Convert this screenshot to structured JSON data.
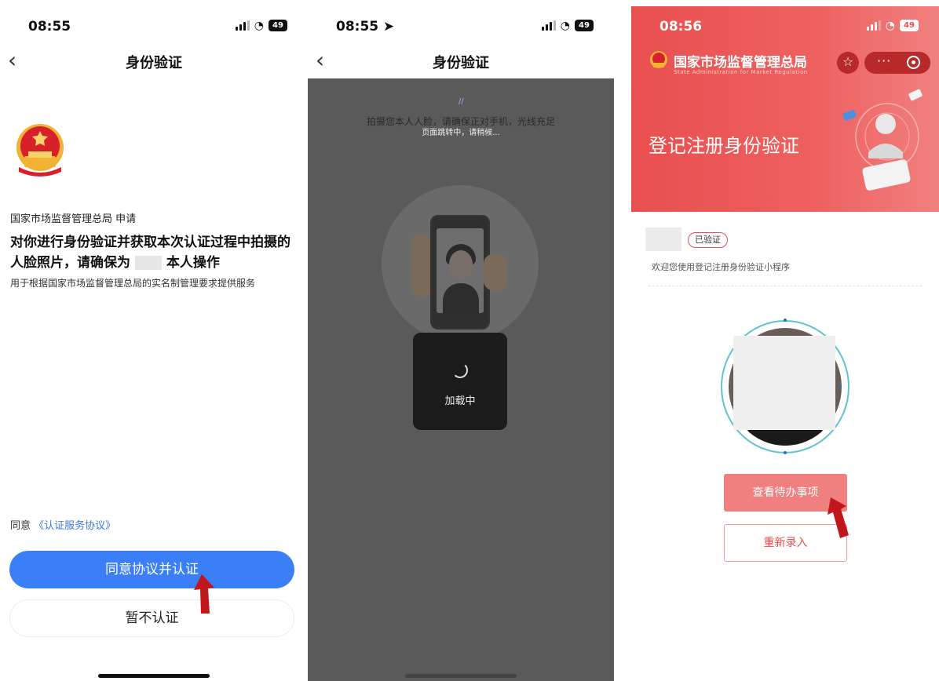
{
  "panel1": {
    "status": {
      "time": "08:55",
      "battery": "49"
    },
    "nav": {
      "back_icon": "chevron-left-icon",
      "title": "身份验证"
    },
    "requester": "国家市场监督管理总局 申请",
    "main_text_1": "对你进行身份验证并获取本次认证过程中拍摄的人脸照片，请确保为",
    "main_text_2": "本人操作",
    "sub_text": "用于根据国家市场监督管理总局的实名制管理要求提供服务",
    "agree_prefix": "同意",
    "agree_link": "《认证服务协议》",
    "primary_button": "同意协议并认证",
    "secondary_button": "暂不认证"
  },
  "panel2": {
    "status": {
      "time": "08:55",
      "battery": "49"
    },
    "nav": {
      "back_icon": "chevron-left-icon",
      "title": "身份验证"
    },
    "hint_line_1": "拍摄您本人人脸，请确保正对手机，光线充足",
    "hint_line_2": "页面跳转中，请稍候...",
    "loading_text": "加载中"
  },
  "panel3": {
    "status": {
      "time": "08:56",
      "battery": "49"
    },
    "org_name": "国家市场监督管理总局",
    "org_name_en": "State Administration for Market Regulation",
    "hero_title": "登记注册身份验证",
    "verified_badge": "已验证",
    "welcome": "欢迎您使用登记注册身份验证小程序",
    "view_button": "查看待办事项",
    "reenter_button": "重新录入"
  },
  "colors": {
    "blue_primary": "#3a7ff6",
    "red_brand": "#e94f4f",
    "red_button": "#f07f7f",
    "cursor_red": "#c0161c"
  }
}
